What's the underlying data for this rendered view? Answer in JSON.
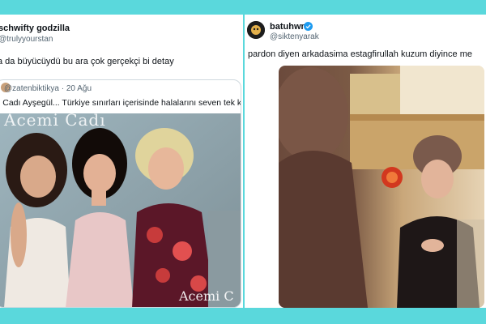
{
  "left_tweet": {
    "display_name": "schwifty godzilla",
    "handle": "@trulyyourstan",
    "text": "a da büyücüydü bu ara çok gerçekçi bi detay",
    "quoted": {
      "handle": "@zatenbiktikya",
      "date": "· 20 Ağu",
      "text": "i Cadı Ayşegül... Türkiye sınırları içerisinde halalarını seven tek kız",
      "watermark_top": "Acemi Cadı",
      "watermark_bottom": "Acemi C"
    }
  },
  "right_tweet": {
    "display_name": "batuhwn",
    "handle": "@siktenyarak",
    "text": "pardon diyen arkadasima estagfirullah kuzum diyince me",
    "verified_color": "#1d9bf0"
  },
  "colors": {
    "background": "#5ad8dc",
    "card": "#ffffff",
    "text": "#0f1419",
    "secondary_text": "#536471"
  }
}
